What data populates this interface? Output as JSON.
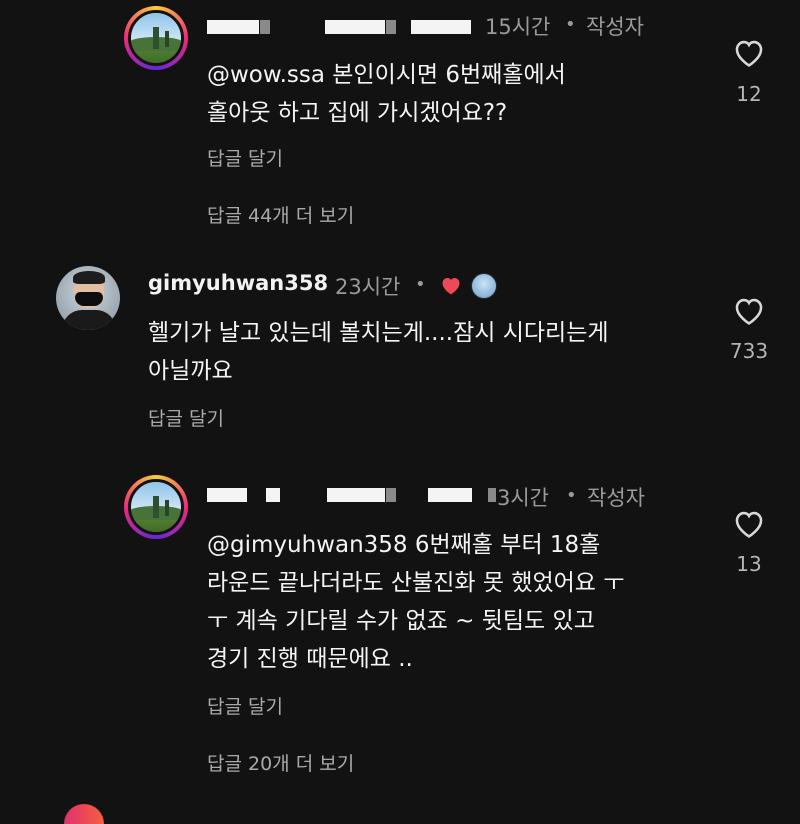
{
  "comments": [
    {
      "time": "15시간",
      "author_badge": "작성자",
      "text_line1": "@wow.ssa 본인이시면 6번째홀에서",
      "text_line2": "홀아웃 하고 집에 가시겠어요??",
      "reply_label": "답글 달기",
      "view_replies": "답글 44개 더 보기",
      "likes": "12"
    },
    {
      "username": "gimyuhwan358",
      "time": "23시간",
      "text_line1": "헬기가 날고 있는데 볼치는게....잠시 시다리는게",
      "text_line2": "아닐까요",
      "reply_label": "답글 달기",
      "likes": "733"
    },
    {
      "time": "23시간",
      "time_display": "3시간",
      "author_badge": "작성자",
      "text_line1": "@gimyuhwan358 6번째홀 부터 18홀",
      "text_line2": "라운드 끝나더라도 산불진화 못 했었어요 ㅜ",
      "text_line3": "ㅜ 계속 기다릴 수가 없죠 ~ 뒷팀도 있고",
      "text_line4": "경기 진행 때문에요 ..",
      "reply_label": "답글 달기",
      "view_replies": "답글 20개 더 보기",
      "likes": "13"
    }
  ],
  "separator": "•",
  "colors": {
    "background": "#121212",
    "creator_heart": "#ed4956",
    "secondary_text": "#9a9a9a"
  },
  "icons": {
    "like": "heart-outline-icon",
    "creator_like": "heart-filled-icon"
  }
}
